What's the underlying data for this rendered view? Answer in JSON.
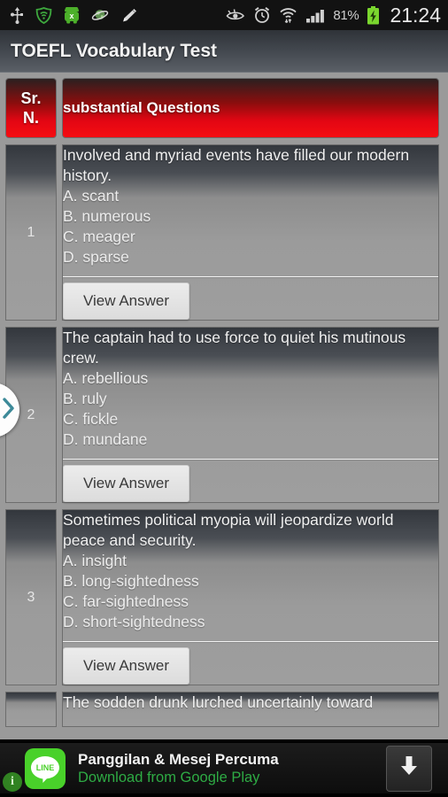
{
  "statusbar": {
    "left_icons": [
      "usb-icon",
      "vpn-shield-icon",
      "android-robot-icon",
      "planet-icon",
      "pencil-icon"
    ],
    "right_icons": [
      "eye-icon",
      "alarm-clock-icon",
      "wifi-transfer-icon",
      "signal-bars-icon",
      "battery-charging-icon"
    ],
    "battery_percent": "81%",
    "clock": "21:24"
  },
  "titlebar": {
    "title": "TOEFL Vocabulary Test"
  },
  "table": {
    "header": {
      "sr_no": "Sr.\nN.",
      "sr_no_line1": "Sr.",
      "sr_no_line2": "N.",
      "question_col": "substantial Questions"
    },
    "view_answer_label": "View Answer",
    "rows": [
      {
        "sr": "1",
        "question": "Involved and myriad events have filled our modern history.",
        "options": [
          "A. scant",
          "B. numerous",
          "C. meager",
          "D. sparse"
        ]
      },
      {
        "sr": "2",
        "question": "The captain had to use force to quiet his mutinous crew.",
        "options": [
          "A. rebellious",
          "B. ruly",
          "C. fickle",
          "D. mundane"
        ]
      },
      {
        "sr": "3",
        "question": "Sometimes political myopia will jeopardize world peace and security.",
        "options": [
          "A. insight",
          "B. long-sightedness",
          "C. far-sightedness",
          "D. short-sightedness"
        ]
      },
      {
        "sr": "",
        "question": "The sodden drunk lurched uncertainly toward",
        "options": []
      }
    ]
  },
  "pulltab": {
    "icon": "chevron-right-icon",
    "color": "#3d8a99"
  },
  "ad": {
    "logo_text": "LINE",
    "title": "Panggilan & Mesej Percuma",
    "subtitle": "Download from Google Play",
    "download_icon": "download-arrow-icon",
    "info_label": "i",
    "brand_color": "#49d12a",
    "subtitle_color": "#2eab44"
  }
}
